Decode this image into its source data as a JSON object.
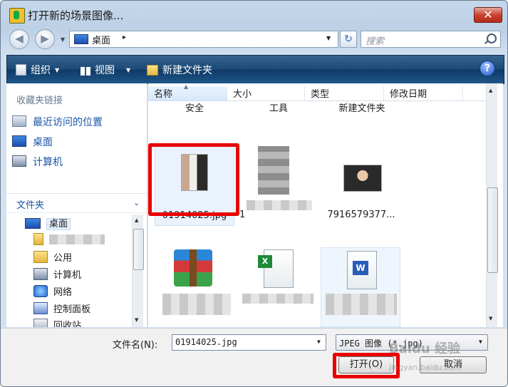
{
  "window": {
    "title": "打开新的场景图像...",
    "close": "✕"
  },
  "address": {
    "location": "桌面",
    "search_placeholder": "搜索"
  },
  "toolbar": {
    "organize": "组织",
    "views": "视图",
    "new_folder": "新建文件夹",
    "help": "?"
  },
  "nav": {
    "favorites_header": "收藏夹链接",
    "favorites": [
      "最近访问的位置",
      "桌面",
      "计算机"
    ],
    "folders_header": "文件夹",
    "tree": [
      "桌面",
      "公用",
      "计算机",
      "网络",
      "控制面板",
      "回收站"
    ]
  },
  "columns": [
    "名称",
    "大小",
    "类型",
    "修改日期"
  ],
  "folders_row": [
    "安全",
    "工具",
    "新建文件夹"
  ],
  "files": [
    {
      "name": "01914025.jpg",
      "selected": true
    },
    {
      "name": "1",
      "selected": false
    },
    {
      "name": "7916579377...",
      "selected": false
    }
  ],
  "footer": {
    "filename_label": "文件名(N):",
    "filename_value": "01914025.jpg",
    "filetype": "JPEG 图像 (*.jpg)",
    "open_button": "打开(O)",
    "cancel_button": "取消",
    "watermark": "Baidu 经验",
    "watermark_url": "jingyan.baidu.com"
  },
  "colors": {
    "highlight": "#e80000",
    "toolbar": "#1c4b78",
    "link": "#1a54a8"
  }
}
